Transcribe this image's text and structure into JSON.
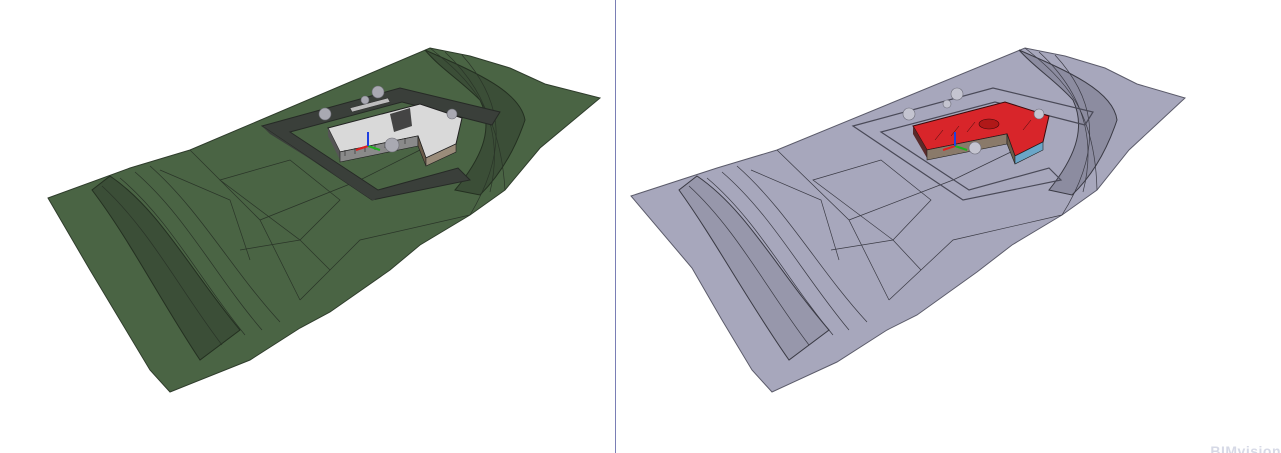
{
  "viewports": [
    {
      "id": "left",
      "render_mode": "shaded-green",
      "terrain_color": "#4a6444",
      "mesh_color": "#2a3528",
      "roof_color": "#e6e6e6"
    },
    {
      "id": "right",
      "render_mode": "shaded-lavender",
      "terrain_color": "#a7a7bc",
      "mesh_color": "#3a3a44",
      "roof_color": "#d8252a"
    }
  ],
  "axis_colors": {
    "x": "#e02020",
    "y": "#20b020",
    "z": "#2040e0"
  },
  "splitter_color": "#7a7fb5",
  "watermark": {
    "text": "BIMvision"
  }
}
